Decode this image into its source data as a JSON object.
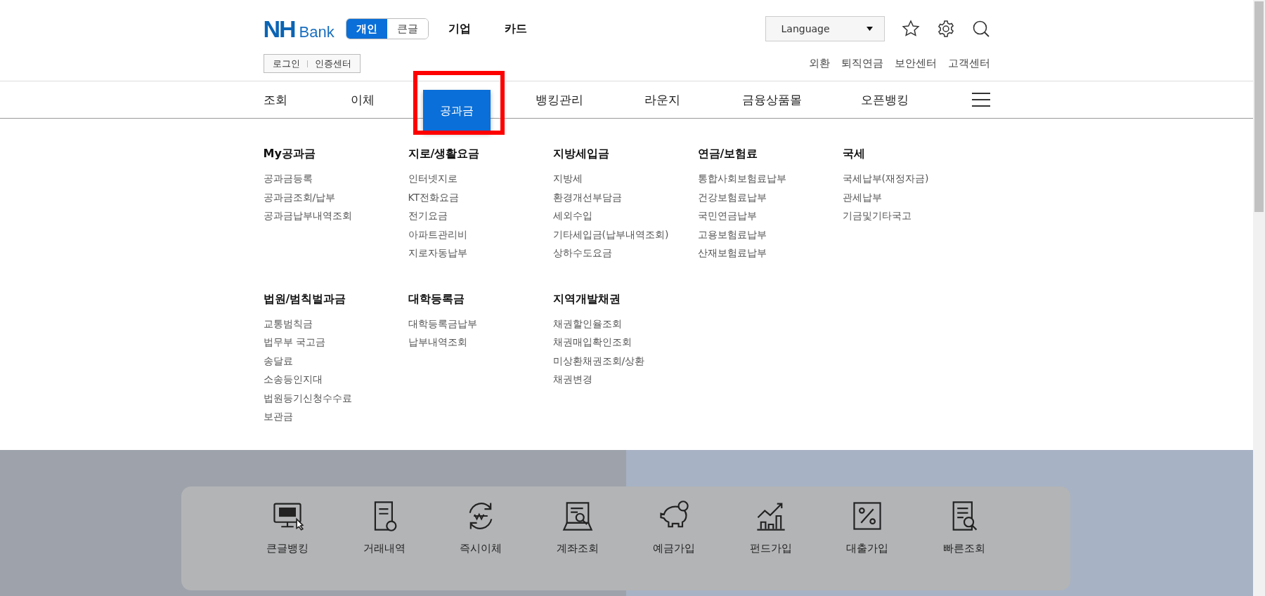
{
  "logo": {
    "mark": "NH",
    "word": "Bank"
  },
  "mode_toggle": [
    {
      "label": "개인",
      "selected": true
    },
    {
      "label": "큰글",
      "selected": false
    }
  ],
  "top_links": [
    "기업",
    "카드"
  ],
  "language": {
    "label": "Language"
  },
  "login_links": [
    "로그인",
    "인증센터"
  ],
  "util_links": [
    "외환",
    "퇴직연금",
    "보안센터",
    "고객센터"
  ],
  "main_nav": [
    {
      "label": "조회",
      "selected": false
    },
    {
      "label": "이체",
      "selected": false
    },
    {
      "label": "공과금",
      "selected": true
    },
    {
      "label": "뱅킹관리",
      "selected": false
    },
    {
      "label": "라운지",
      "selected": false
    },
    {
      "label": "금융상품몰",
      "selected": false
    },
    {
      "label": "오픈뱅킹",
      "selected": false
    }
  ],
  "mega_menu": [
    [
      {
        "title": "My공과금",
        "items": [
          "공과금등록",
          "공과금조회/납부",
          "공과금납부내역조회"
        ]
      },
      {
        "title": "지로/생활요금",
        "items": [
          "인터넷지로",
          "KT전화요금",
          "전기요금",
          "아파트관리비",
          "지로자동납부"
        ]
      },
      {
        "title": "지방세입금",
        "items": [
          "지방세",
          "환경개선부담금",
          "세외수입",
          "기타세입금(납부내역조회)",
          "상하수도요금"
        ]
      },
      {
        "title": "연금/보험료",
        "items": [
          "통합사회보험료납부",
          "건강보험료납부",
          "국민연금납부",
          "고용보험료납부",
          "산재보험료납부"
        ]
      },
      {
        "title": "국세",
        "items": [
          "국세납부(재정자금)",
          "관세납부",
          "기금및기타국고"
        ]
      }
    ],
    [
      {
        "title": "법원/범칙벌과금",
        "items": [
          "교통범칙금",
          "법무부 국고금",
          "송달료",
          "소송등인지대",
          "법원등기신청수수료",
          "보관금"
        ]
      },
      {
        "title": "대학등록금",
        "items": [
          "대학등록금납부",
          "납부내역조회"
        ]
      },
      {
        "title": "지역개발채권",
        "items": [
          "채권할인율조회",
          "채권매입확인조회",
          "미상환채권조회/상환",
          "채권변경"
        ]
      }
    ]
  ],
  "quick_menu": [
    "큰글뱅킹",
    "거래내역",
    "즉시이체",
    "계좌조회",
    "예금가입",
    "펀드가입",
    "대출가입",
    "빠른조회"
  ]
}
